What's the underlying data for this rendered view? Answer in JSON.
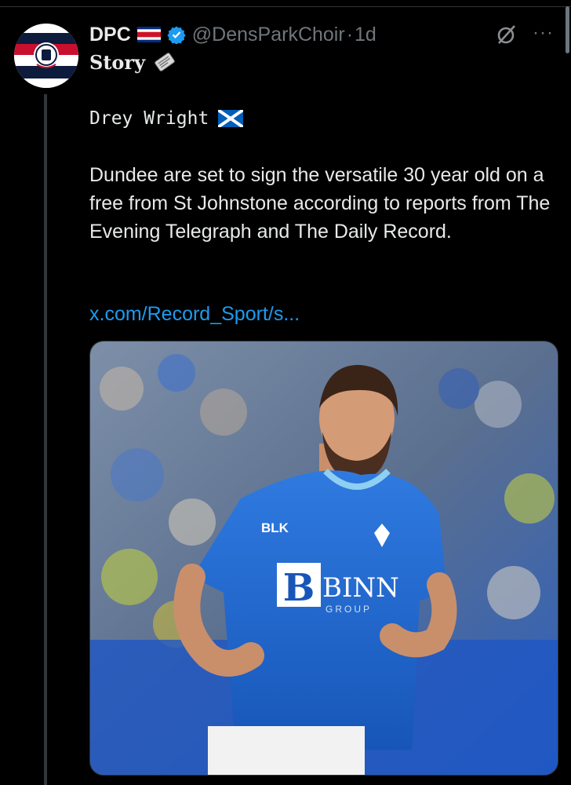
{
  "colors": {
    "background": "#000000",
    "text": "#e7e9ea",
    "muted": "#71767b",
    "link": "#1d9bf0",
    "verified": "#1d9bf0",
    "kit_blue": "#1e63c9"
  },
  "post": {
    "author_name": "DPC",
    "author_flag": "flag-costa-rica-icon",
    "verified_icon": "verified-badge-icon",
    "handle": "@DensParkChoir",
    "separator": "·",
    "time": "1d",
    "subtitle": "Story",
    "subtitle_icon": "newspaper-icon",
    "grok_icon": "grok-icon",
    "more_label": "···",
    "player_line": "Drey Wright",
    "player_flag": "flag-scotland-icon",
    "body": "Dundee are set to sign the versatile 30 year old on a free from St Johnstone according to reports from The Evening Telegraph and The Daily Record.",
    "link": "x.com/Record_Sport/s...",
    "media": {
      "kit_sponsor": "BLK",
      "shirt_sponsor": "BINN",
      "shirt_sponsor_sub": "GROUP"
    }
  }
}
